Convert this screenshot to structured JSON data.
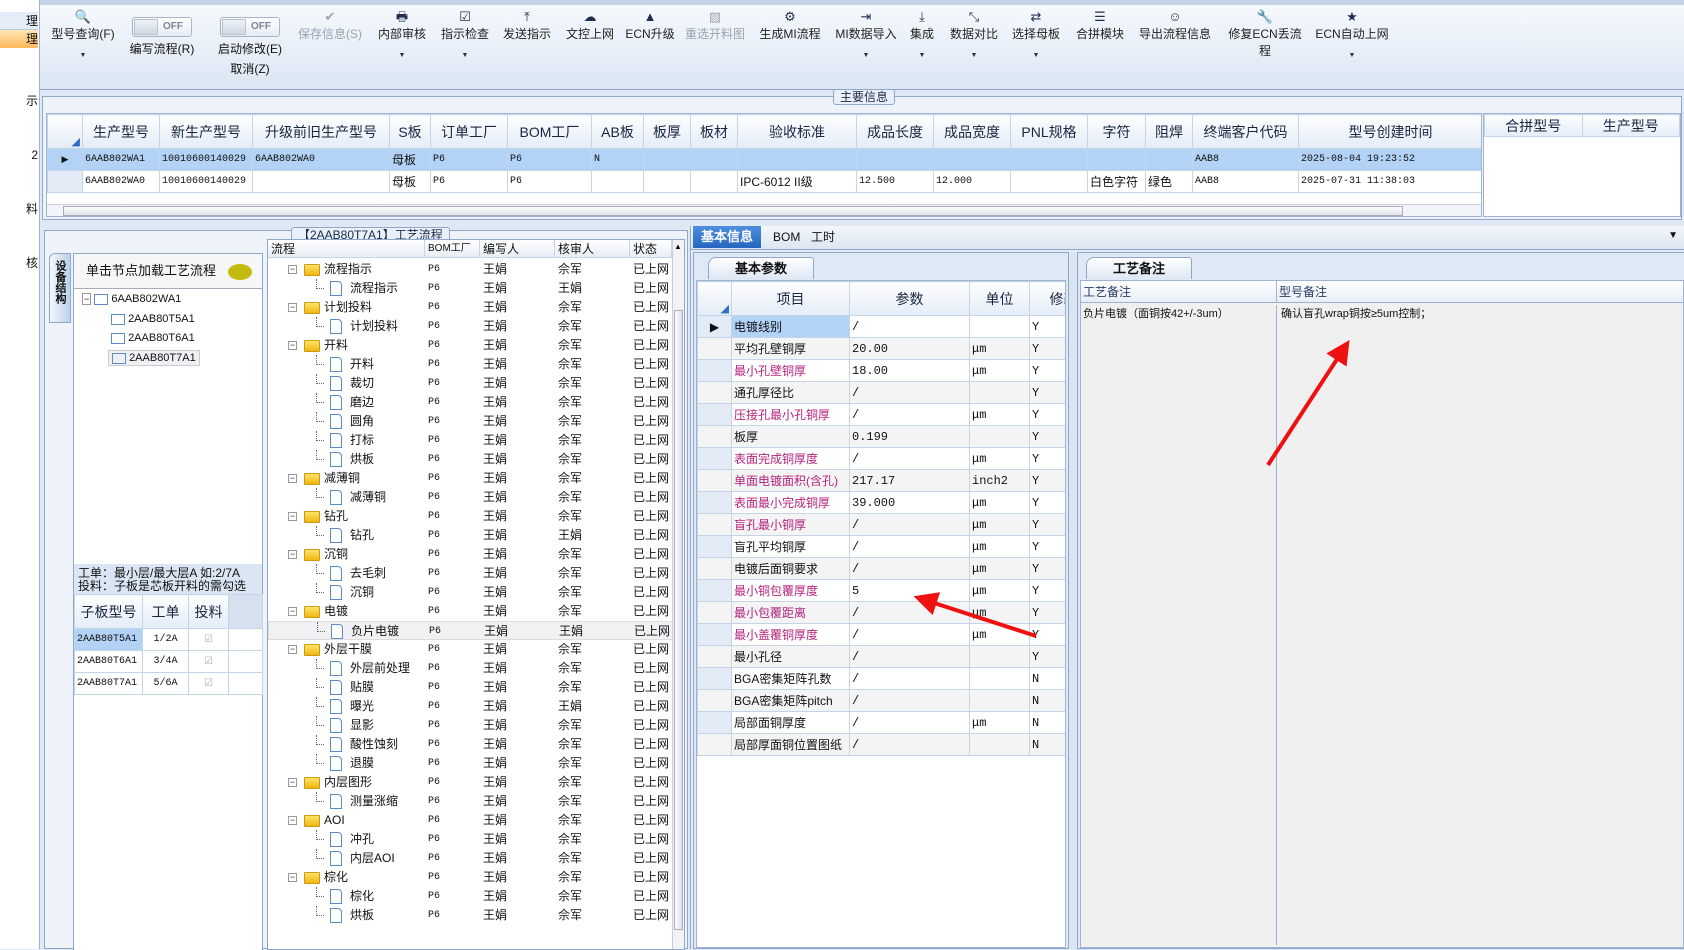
{
  "left_nav": {
    "items": [
      {
        "label": "理",
        "selected": false
      },
      {
        "label": "理",
        "selected": true
      },
      {
        "label": "示"
      },
      {
        "label": "2"
      },
      {
        "label": "料"
      },
      {
        "label": "核"
      }
    ]
  },
  "toolbar": {
    "buttons": [
      {
        "label": "型号查询(F)",
        "icon": "search-icon",
        "glyph": "🔍",
        "dropdown": true,
        "enabled": true
      },
      {
        "label": "保存信息(S)",
        "icon": "check-icon",
        "glyph": "✔",
        "dropdown": false,
        "enabled": false
      },
      {
        "label": "内部审核",
        "icon": "print-icon",
        "glyph": "🖶",
        "dropdown": true,
        "enabled": true
      },
      {
        "label": "指示检查",
        "icon": "checkbox-icon",
        "glyph": "☑",
        "dropdown": true,
        "enabled": true
      },
      {
        "label": "发送指示",
        "icon": "upload-icon",
        "glyph": "⤒",
        "dropdown": false,
        "enabled": true
      },
      {
        "label": "文控上网",
        "icon": "cloud-upload-icon",
        "glyph": "☁",
        "dropdown": false,
        "enabled": true
      },
      {
        "label": "ECN升级",
        "icon": "road-icon",
        "glyph": "▲",
        "dropdown": false,
        "enabled": true
      },
      {
        "label": "重选开料图",
        "icon": "image-icon",
        "glyph": "▨",
        "dropdown": false,
        "enabled": false
      },
      {
        "label": "生成MI流程",
        "icon": "gears-icon",
        "glyph": "⚙",
        "dropdown": false,
        "enabled": true
      },
      {
        "label": "MI数据导入",
        "icon": "import-icon",
        "glyph": "⇥",
        "dropdown": true,
        "enabled": true
      },
      {
        "label": "集成",
        "icon": "download-icon",
        "glyph": "⤓",
        "dropdown": true,
        "enabled": true
      },
      {
        "label": "数据对比",
        "icon": "compress-icon",
        "glyph": "⤡",
        "dropdown": true,
        "enabled": true
      },
      {
        "label": "选择母板",
        "icon": "shuffle-icon",
        "glyph": "⇄",
        "dropdown": true,
        "enabled": true
      },
      {
        "label": "合拼模块",
        "icon": "list-icon",
        "glyph": "☰",
        "dropdown": false,
        "enabled": true
      },
      {
        "label": "导出流程信息",
        "icon": "smile-icon",
        "glyph": "☺",
        "dropdown": false,
        "enabled": true
      },
      {
        "label": "修复ECN丢流程",
        "icon": "wrench-icon",
        "glyph": "🔧",
        "dropdown": false,
        "enabled": true
      },
      {
        "label": "ECN自动上网",
        "icon": "star-icon",
        "glyph": "★",
        "dropdown": true,
        "enabled": true
      }
    ],
    "toggles": [
      {
        "state": "OFF",
        "label": "编写流程(R)",
        "label2": ""
      },
      {
        "state": "OFF",
        "label": "启动修改(E)",
        "label2": "取消(Z)"
      }
    ]
  },
  "main_info": {
    "title": "主要信息",
    "columns": [
      "生产型号",
      "新生产型号",
      "升级前旧生产型号",
      "S板",
      "订单工厂",
      "BOM工厂",
      "AB板",
      "板厚",
      "板材",
      "验收标准",
      "成品长度",
      "成品宽度",
      "PNL规格",
      "字符",
      "阻焊",
      "终端客户代码",
      "型号创建时间"
    ],
    "rows": [
      {
        "selected": true,
        "cells": [
          "6AAB802WA1",
          "10010600140029",
          "6AAB802WA0",
          "母板",
          "P6",
          "P6",
          "N",
          "",
          "",
          "",
          "",
          "",
          "",
          "",
          "",
          "AAB8",
          "2025-08-04 19:23:52"
        ]
      },
      {
        "selected": false,
        "cells": [
          "6AAB802WA0",
          "10010600140029",
          "",
          "母板",
          "P6",
          "P6",
          "",
          "",
          "",
          "IPC-6012 II级",
          "12.500",
          "12.000",
          "",
          "白色字符",
          "绿色",
          "AAB8",
          "2025-07-31 11:38:03"
        ]
      }
    ],
    "side_columns": [
      "合拼型号",
      "生产型号"
    ]
  },
  "process_group": {
    "title": "【2AAB80T7A1】工艺流程"
  },
  "structure": {
    "vertical_tab": "设备结构",
    "header": "单击节点加载工艺流程",
    "tree": {
      "root": "6AAB802WA1",
      "children": [
        "2AAB80T5A1",
        "2AAB80T6A1",
        "2AAB80T7A1"
      ],
      "selected": "2AAB80T7A1"
    },
    "note_line1": "工单：最小层/最大层A 如:2/7A",
    "note_line2": "投料：子板是芯板开料的需勾选",
    "sub_columns": [
      "子板型号",
      "工单",
      "投料"
    ],
    "sub_rows": [
      {
        "model": "2AAB80T5A1",
        "order": "1/2A",
        "feed": true
      },
      {
        "model": "2AAB80T6A1",
        "order": "3/4A",
        "feed": true
      },
      {
        "model": "2AAB80T7A1",
        "order": "5/6A",
        "feed": true
      }
    ]
  },
  "process": {
    "columns": [
      "流程",
      "BOM工厂",
      "编写人",
      "核审人",
      "状态"
    ],
    "rows": [
      [
        0,
        "流程指示",
        "P6",
        "王娟",
        "佘军",
        "已上网"
      ],
      [
        1,
        "流程指示",
        "P6",
        "王娟",
        "王娟",
        "已上网"
      ],
      [
        0,
        "计划投料",
        "P6",
        "王娟",
        "佘军",
        "已上网"
      ],
      [
        1,
        "计划投料",
        "P6",
        "王娟",
        "佘军",
        "已上网"
      ],
      [
        0,
        "开料",
        "P6",
        "王娟",
        "佘军",
        "已上网"
      ],
      [
        1,
        "开料",
        "P6",
        "王娟",
        "佘军",
        "已上网"
      ],
      [
        1,
        "裁切",
        "P6",
        "王娟",
        "佘军",
        "已上网"
      ],
      [
        1,
        "磨边",
        "P6",
        "王娟",
        "佘军",
        "已上网"
      ],
      [
        1,
        "圆角",
        "P6",
        "王娟",
        "佘军",
        "已上网"
      ],
      [
        1,
        "打标",
        "P6",
        "王娟",
        "佘军",
        "已上网"
      ],
      [
        1,
        "烘板",
        "P6",
        "王娟",
        "佘军",
        "已上网"
      ],
      [
        0,
        "减薄铜",
        "P6",
        "王娟",
        "佘军",
        "已上网"
      ],
      [
        1,
        "减薄铜",
        "P6",
        "王娟",
        "佘军",
        "已上网"
      ],
      [
        0,
        "钻孔",
        "P6",
        "王娟",
        "佘军",
        "已上网"
      ],
      [
        1,
        "钻孔",
        "P6",
        "王娟",
        "王娟",
        "已上网"
      ],
      [
        0,
        "沉铜",
        "P6",
        "王娟",
        "佘军",
        "已上网"
      ],
      [
        1,
        "去毛刺",
        "P6",
        "王娟",
        "佘军",
        "已上网"
      ],
      [
        1,
        "沉铜",
        "P6",
        "王娟",
        "佘军",
        "已上网"
      ],
      [
        0,
        "电镀",
        "P6",
        "王娟",
        "佘军",
        "已上网"
      ],
      [
        1,
        "负片电镀",
        "P6",
        "王娟",
        "王娟",
        "已上网"
      ],
      [
        0,
        "外层干膜",
        "P6",
        "王娟",
        "佘军",
        "已上网"
      ],
      [
        1,
        "外层前处理",
        "P6",
        "王娟",
        "佘军",
        "已上网"
      ],
      [
        1,
        "贴膜",
        "P6",
        "王娟",
        "佘军",
        "已上网"
      ],
      [
        1,
        "曝光",
        "P6",
        "王娟",
        "王娟",
        "已上网"
      ],
      [
        1,
        "显影",
        "P6",
        "王娟",
        "佘军",
        "已上网"
      ],
      [
        1,
        "酸性蚀刻",
        "P6",
        "王娟",
        "佘军",
        "已上网"
      ],
      [
        1,
        "退膜",
        "P6",
        "王娟",
        "佘军",
        "已上网"
      ],
      [
        0,
        "内层图形",
        "P6",
        "王娟",
        "佘军",
        "已上网"
      ],
      [
        1,
        "测量涨缩",
        "P6",
        "王娟",
        "佘军",
        "已上网"
      ],
      [
        0,
        "AOI",
        "P6",
        "王娟",
        "佘军",
        "已上网"
      ],
      [
        1,
        "冲孔",
        "P6",
        "王娟",
        "佘军",
        "已上网"
      ],
      [
        1,
        "内层AOI",
        "P6",
        "王娟",
        "佘军",
        "已上网"
      ],
      [
        0,
        "棕化",
        "P6",
        "王娟",
        "佘军",
        "已上网"
      ],
      [
        1,
        "棕化",
        "P6",
        "王娟",
        "佘军",
        "已上网"
      ],
      [
        1,
        "烘板",
        "P6",
        "王娟",
        "佘军",
        "已上网"
      ]
    ],
    "selected_index": 19
  },
  "detail_tabs": {
    "tabs": [
      "基本信息",
      "BOM",
      "工时"
    ],
    "active": 0
  },
  "params": {
    "tab": "基本参数",
    "columns": [
      "项目",
      "参数",
      "单位",
      "修改"
    ],
    "rows": [
      {
        "item": "电镀线别",
        "value": "/",
        "unit": "",
        "mod": "Y",
        "pink": false
      },
      {
        "item": "平均孔壁铜厚",
        "value": "20.00",
        "unit": "μm",
        "mod": "Y",
        "pink": false
      },
      {
        "item": "最小孔壁铜厚",
        "value": "18.00",
        "unit": "μm",
        "mod": "Y",
        "pink": true
      },
      {
        "item": "通孔厚径比",
        "value": "/",
        "unit": "",
        "mod": "Y",
        "pink": false
      },
      {
        "item": "压接孔最小孔铜厚",
        "value": "/",
        "unit": "μm",
        "mod": "Y",
        "pink": true
      },
      {
        "item": "板厚",
        "value": "0.199",
        "unit": "",
        "mod": "Y",
        "pink": false
      },
      {
        "item": "表面完成铜厚度",
        "value": "/",
        "unit": "μm",
        "mod": "Y",
        "pink": true
      },
      {
        "item": "单面电镀面积(含孔)",
        "value": "217.17",
        "unit": "inch2",
        "mod": "Y",
        "pink": true
      },
      {
        "item": "表面最小完成铜厚",
        "value": "39.000",
        "unit": "μm",
        "mod": "Y",
        "pink": true
      },
      {
        "item": "盲孔最小铜厚",
        "value": "/",
        "unit": "μm",
        "mod": "Y",
        "pink": true
      },
      {
        "item": "盲孔平均铜厚",
        "value": "/",
        "unit": "μm",
        "mod": "Y",
        "pink": false
      },
      {
        "item": "电镀后面铜要求",
        "value": "/",
        "unit": "μm",
        "mod": "Y",
        "pink": false
      },
      {
        "item": "最小铜包覆厚度",
        "value": "5",
        "unit": "μm",
        "mod": "Y",
        "pink": true
      },
      {
        "item": "最小包覆距离",
        "value": "/",
        "unit": "μm",
        "mod": "Y",
        "pink": true
      },
      {
        "item": "最小盖覆铜厚度",
        "value": "/",
        "unit": "μm",
        "mod": "Y",
        "pink": true
      },
      {
        "item": "最小孔径",
        "value": "/",
        "unit": "",
        "mod": "Y",
        "pink": false
      },
      {
        "item": "BGA密集矩阵孔数",
        "value": "/",
        "unit": "",
        "mod": "N",
        "pink": false
      },
      {
        "item": "BGA密集矩阵pitch",
        "value": "/",
        "unit": "",
        "mod": "N",
        "pink": false
      },
      {
        "item": "局部面铜厚度",
        "value": "/",
        "unit": "μm",
        "mod": "N",
        "pink": false
      },
      {
        "item": "局部厚面铜位置图纸",
        "value": "/",
        "unit": "",
        "mod": "N",
        "pink": false
      }
    ]
  },
  "remarks": {
    "tab": "工艺备注",
    "columns": [
      "工艺备注",
      "型号备注"
    ],
    "process_remark": "负片电镀（面铜按42+/-3um）",
    "model_remark": "确认盲孔wrap铜按≥5um控制；"
  },
  "colors": {
    "accent": "#2f6fc0",
    "selected_row": "#b3d3f6",
    "highlight_text": "#b4237e",
    "annotation_arrow": "#ee1111"
  }
}
